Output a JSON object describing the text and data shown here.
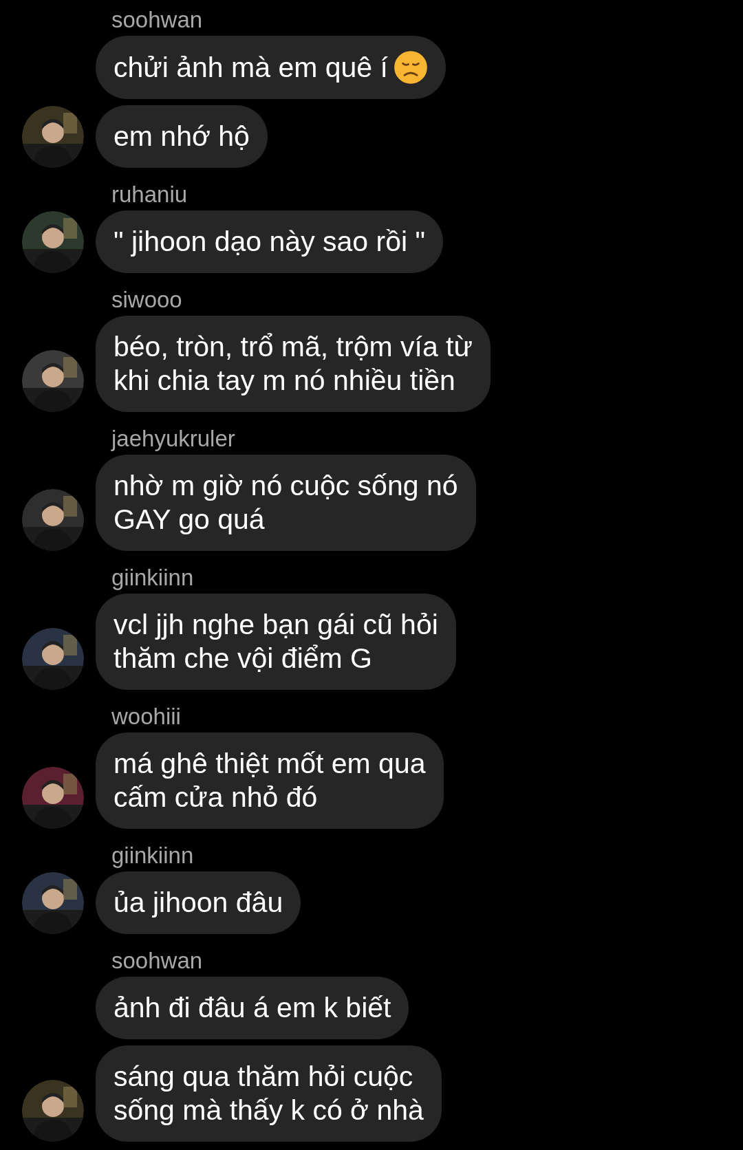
{
  "groups": [
    {
      "sender": "soohwan",
      "messages": [
        {
          "text": "chửi ảnh mà em quê í",
          "emoji": true
        },
        {
          "text": "em nhớ hộ",
          "emoji": false
        }
      ]
    },
    {
      "sender": "ruhaniu",
      "messages": [
        {
          "text": "\" jihoon dạo này sao rồi \"",
          "emoji": false
        }
      ]
    },
    {
      "sender": "siwooo",
      "messages": [
        {
          "text": "béo, tròn, trổ mã, trộm vía từ\nkhi chia tay m nó nhiều tiền",
          "emoji": false
        }
      ]
    },
    {
      "sender": "jaehyukruler",
      "messages": [
        {
          "text": "nhờ m giờ nó cuộc sống nó\nGAY go quá",
          "emoji": false
        }
      ]
    },
    {
      "sender": "giinkiinn",
      "messages": [
        {
          "text": "vcl jjh nghe bạn gái cũ hỏi\nthăm che vội điểm G",
          "emoji": false
        }
      ]
    },
    {
      "sender": "woohiii",
      "messages": [
        {
          "text": "má ghê thiệt mốt em qua\ncấm cửa nhỏ đó",
          "emoji": false
        }
      ]
    },
    {
      "sender": "giinkiinn",
      "messages": [
        {
          "text": "ủa jihoon đâu",
          "emoji": false
        }
      ]
    },
    {
      "sender": "soohwan",
      "messages": [
        {
          "text": "ảnh đi đâu á em k biết",
          "emoji": false
        },
        {
          "text": "sáng qua thăm hỏi cuộc\nsống mà thấy k có ở nhà",
          "emoji": false
        }
      ]
    }
  ]
}
